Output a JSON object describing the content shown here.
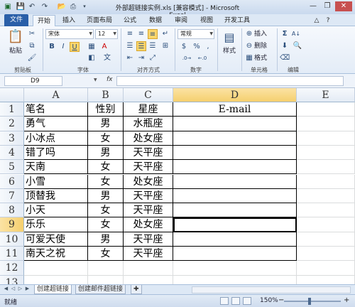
{
  "window": {
    "title": "外部超链接实例.xls [兼容模式] - Microsoft Excel",
    "quick_access": [
      "save-icon",
      "undo-icon",
      "redo-icon",
      "open-icon",
      "print-preview-icon",
      "customize-icon"
    ],
    "controls": [
      "minimize-icon",
      "maximize-icon",
      "close-icon"
    ],
    "controls_glyphs": [
      "—",
      "❐",
      "✕"
    ]
  },
  "ribbon": {
    "file_tab": "文件",
    "tabs": [
      "开始",
      "插入",
      "页面布局",
      "公式",
      "数据",
      "审阅",
      "视图",
      "开发工具"
    ],
    "active_tab": "开始",
    "groups": {
      "clipboard": {
        "label": "剪贴板",
        "paste": "粘贴"
      },
      "font": {
        "label": "字体",
        "font_name": "宋体",
        "font_size": "12",
        "bold": "B",
        "italic": "I",
        "underline": "U",
        "font_color_glyph": "A"
      },
      "alignment": {
        "label": "对齐方式"
      },
      "number": {
        "label": "数字",
        "format": "常规",
        "currency": "$",
        "percent": "%",
        "comma": ","
      },
      "styles": {
        "label": "样式",
        "button": "样式"
      },
      "cells": {
        "label": "单元格",
        "insert": "插入",
        "delete": "删除",
        "format": "格式"
      },
      "editing": {
        "label": "编辑",
        "sum_glyph": "Σ",
        "sort_glyph": "A↓"
      }
    }
  },
  "formula_bar": {
    "name_box": "D9",
    "fx_label": "fx",
    "formula": ""
  },
  "sheet": {
    "columns": [
      "A",
      "B",
      "C",
      "D",
      "E"
    ],
    "rows": [
      "1",
      "2",
      "3",
      "4",
      "5",
      "6",
      "7",
      "8",
      "9",
      "10",
      "11",
      "12",
      "13"
    ],
    "table": [
      [
        "笔名",
        "性别",
        "星座",
        "E-mail"
      ],
      [
        "勇气",
        "男",
        "水瓶座",
        ""
      ],
      [
        "小冰点",
        "女",
        "处女座",
        ""
      ],
      [
        "错了吗",
        "男",
        "天平座",
        ""
      ],
      [
        "天南",
        "女",
        "天平座",
        ""
      ],
      [
        "小雪",
        "女",
        "处女座",
        ""
      ],
      [
        "顶替我",
        "男",
        "天平座",
        ""
      ],
      [
        "小天",
        "女",
        "天平座",
        ""
      ],
      [
        "乐乐",
        "女",
        "处女座",
        ""
      ],
      [
        "可爱天使",
        "男",
        "天平座",
        ""
      ],
      [
        "南天之祝",
        "女",
        "天平座",
        ""
      ]
    ],
    "selected_cell": "D9"
  },
  "sheet_tabs": {
    "tabs": [
      "创建超链接",
      "创建邮件超链接"
    ],
    "active": "创建超链接"
  },
  "status_bar": {
    "ready": "就绪",
    "zoom": "150%"
  },
  "colors": {
    "file_tab": "#2a5fa8",
    "ribbon_bg": "#e3ecf7",
    "highlight": "#fbd66b"
  }
}
